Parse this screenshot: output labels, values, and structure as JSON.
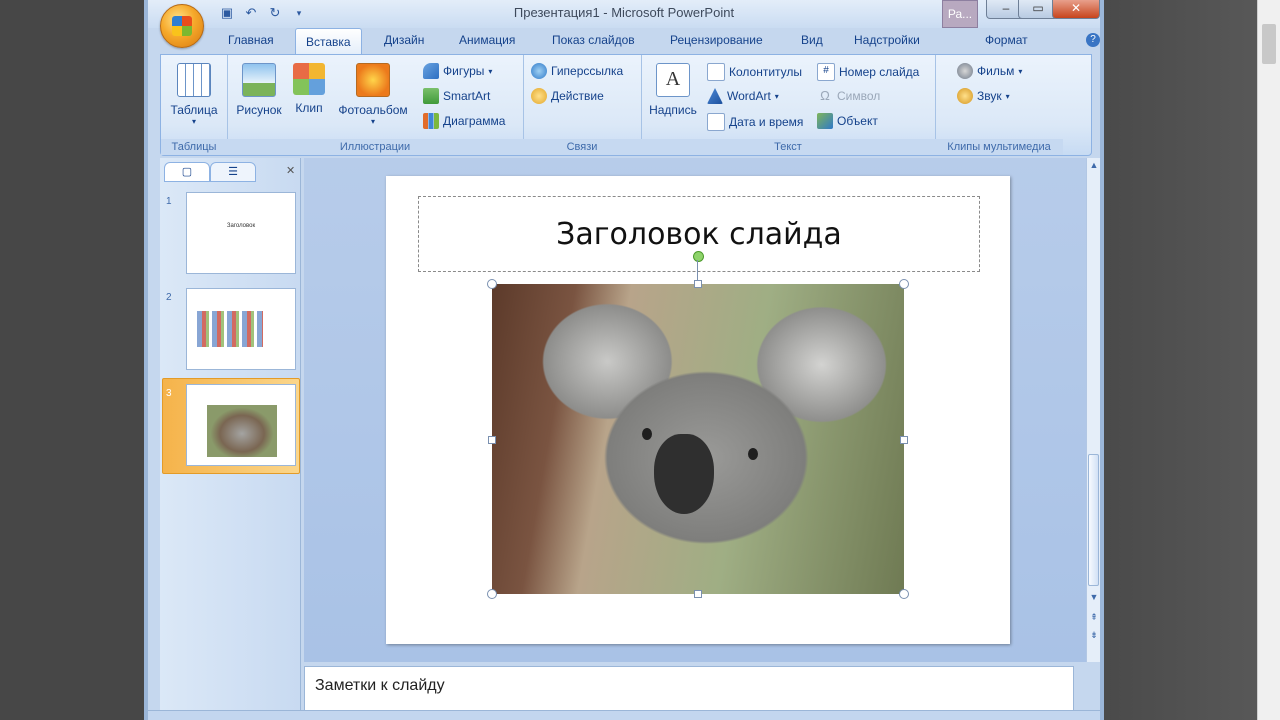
{
  "window": {
    "title": "Презентация1 - Microsoft PowerPoint",
    "extra_button": "Ра..."
  },
  "tabs": [
    "Главная",
    "Вставка",
    "Дизайн",
    "Анимация",
    "Показ слайдов",
    "Рецензирование",
    "Вид",
    "Надстройки",
    "Формат"
  ],
  "active_tab": "Вставка",
  "ribbon": {
    "tables": {
      "label": "Таблицы",
      "table": "Таблица"
    },
    "illustrations": {
      "label": "Иллюстрации",
      "picture": "Рисунок",
      "clip": "Клип",
      "album": "Фотоальбом",
      "shapes": "Фигуры",
      "smartart": "SmartArt",
      "chart": "Диаграмма"
    },
    "links": {
      "label": "Связи",
      "hyperlink": "Гиперссылка",
      "action": "Действие"
    },
    "text": {
      "label": "Текст",
      "textbox": "Надпись",
      "headers": "Колонтитулы",
      "wordart": "WordArt",
      "datetime": "Дата и время",
      "slide_number": "Номер слайда",
      "symbol": "Символ",
      "object": "Объект"
    },
    "media": {
      "label": "Клипы мультимедиа",
      "movie": "Фильм",
      "sound": "Звук"
    }
  },
  "thumbnails": [
    {
      "num": "1",
      "text": "Заголовок"
    },
    {
      "num": "2"
    },
    {
      "num": "3"
    }
  ],
  "slide": {
    "title": "Заголовок слайда"
  },
  "notes": {
    "placeholder": "Заметки к слайду"
  },
  "colors": {
    "accent": "#15428b",
    "ribbon": "#dbe8f7",
    "selection": "#f5b34a"
  }
}
